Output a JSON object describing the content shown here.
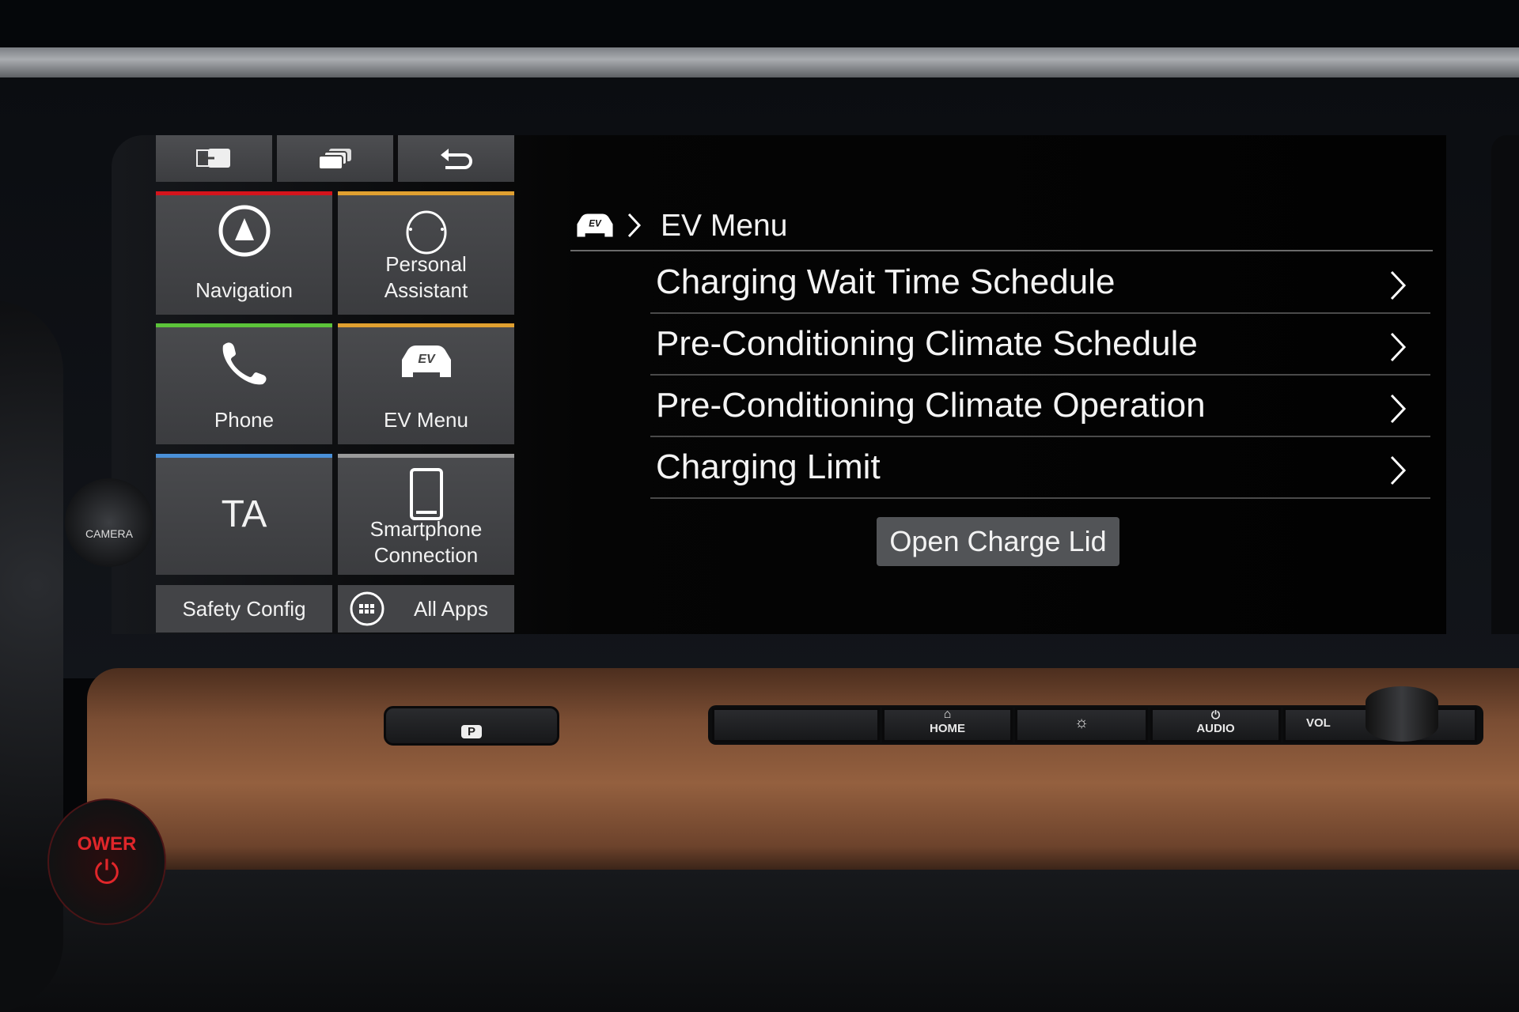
{
  "screen": {
    "top_buttons": [
      {
        "icon": "screen-switch-icon"
      },
      {
        "icon": "stacked-windows-icon"
      },
      {
        "icon": "back-arrow-icon"
      }
    ],
    "tiles": [
      {
        "label": "Navigation",
        "icon": "navigation-compass-icon",
        "accent": "#d4141c"
      },
      {
        "label": "Personal\nAssistant",
        "icon": "assistant-circle-icon",
        "accent": "#e0a030"
      },
      {
        "label": "Phone",
        "icon": "phone-handset-icon",
        "accent": "#5cc43a"
      },
      {
        "label": "EV Menu",
        "icon": "ev-car-icon",
        "accent": "#e0a030"
      },
      {
        "label": "TA",
        "icon": "",
        "accent": "#4a90d8"
      },
      {
        "label": "Smartphone\nConnection",
        "icon": "smartphone-icon",
        "accent": "#9a9a9a"
      }
    ],
    "bottom": {
      "safety": "Safety Config",
      "all_apps": "All Apps"
    },
    "breadcrumb": {
      "icon": "ev-car-icon",
      "title": "EV Menu"
    },
    "menu_items": [
      "Charging Wait Time Schedule",
      "Pre-Conditioning Climate Schedule",
      "Pre-Conditioning Climate Operation",
      "Charging Limit"
    ],
    "open_lid": "Open Charge Lid"
  },
  "dashboard": {
    "home": "HOME",
    "audio": "AUDIO",
    "vol": "VOL",
    "camera": "CAMERA",
    "power": "OWER",
    "park": "P"
  }
}
